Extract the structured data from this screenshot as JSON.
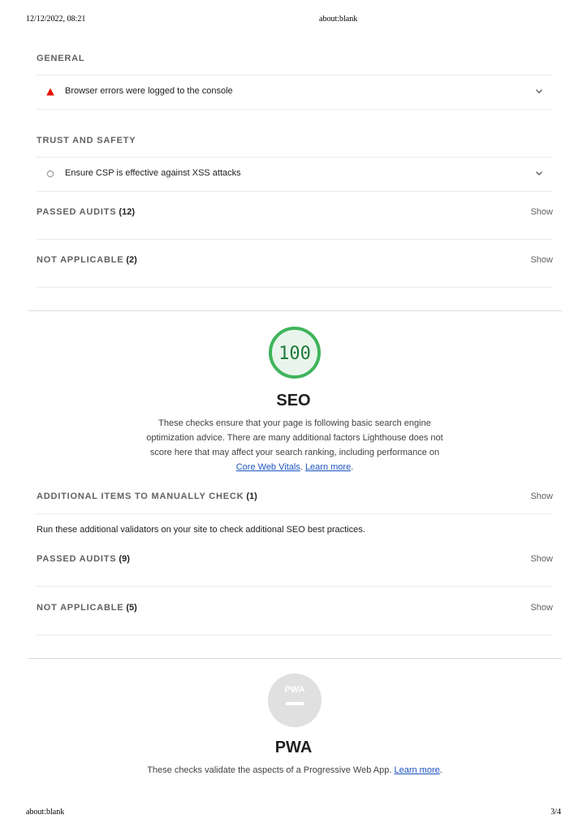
{
  "print": {
    "datetime": "12/12/2022, 08:21",
    "url": "about:blank",
    "footer_url": "about:blank",
    "page": "3/4"
  },
  "best_practices": {
    "general": {
      "title": "GENERAL",
      "audit": {
        "title": "Browser errors were logged to the console",
        "status_icon": "fail-triangle-icon",
        "color": "#eb0f00"
      }
    },
    "trust": {
      "title": "TRUST AND SAFETY",
      "audit": {
        "title": "Ensure CSP is effective against XSS attacks",
        "status_icon": "info-circle-icon",
        "color": "#9e9e9e"
      }
    },
    "passed": {
      "label": "PASSED AUDITS",
      "count": "(12)",
      "action": "Show"
    },
    "not_applicable": {
      "label": "NOT APPLICABLE",
      "count": "(2)",
      "action": "Show"
    }
  },
  "seo": {
    "score": "100",
    "score_color": "#0c9a43",
    "title": "SEO",
    "description_pre": "These checks ensure that your page is following basic search engine optimization advice. There are many additional factors Lighthouse does not score here that may affect your search ranking, including performance on ",
    "link_cwv": "Core Web Vitals",
    "description_mid": ". ",
    "link_learn": "Learn more",
    "description_post": ".",
    "manual": {
      "label": "ADDITIONAL ITEMS TO MANUALLY CHECK",
      "count": "(1)",
      "action": "Show",
      "description": "Run these additional validators on your site to check additional SEO best practices."
    },
    "passed": {
      "label": "PASSED AUDITS",
      "count": "(9)",
      "action": "Show"
    },
    "not_applicable": {
      "label": "NOT APPLICABLE",
      "count": "(5)",
      "action": "Show"
    }
  },
  "pwa": {
    "badge": "PWA",
    "title": "PWA",
    "description_pre": "These checks validate the aspects of a Progressive Web App. ",
    "link_learn": "Learn more",
    "description_post": "."
  }
}
